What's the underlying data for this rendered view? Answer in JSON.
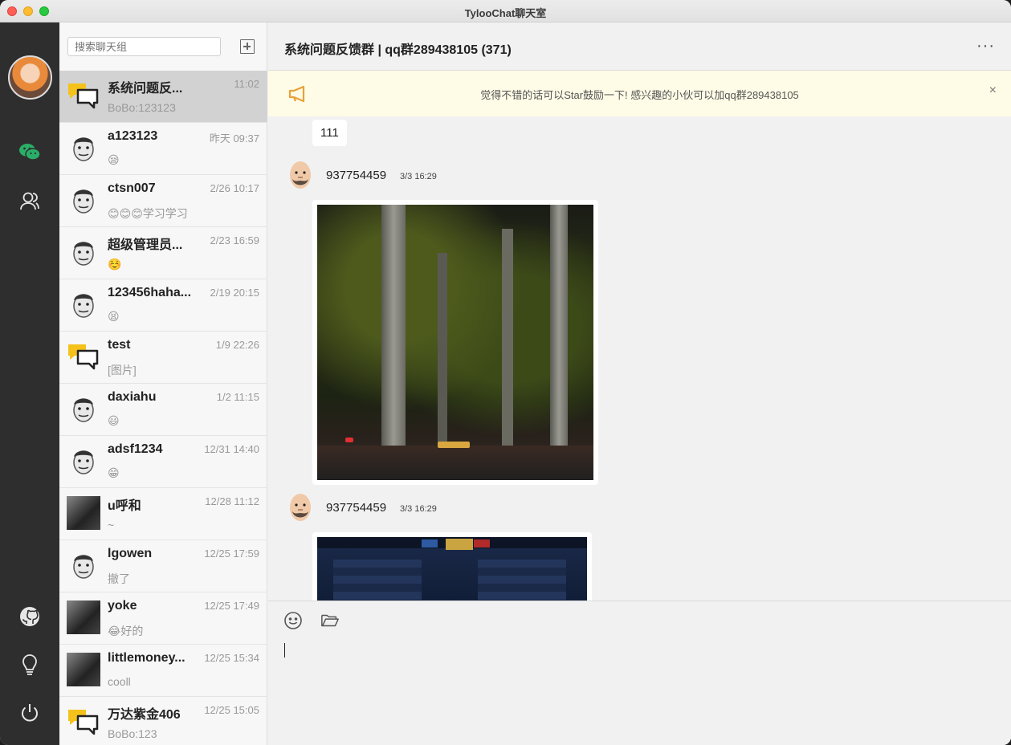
{
  "window": {
    "title": "TylooChat聊天室"
  },
  "search": {
    "placeholder": "搜索聊天组"
  },
  "conversations": [
    {
      "name": "系统问题反...",
      "time": "11:02",
      "preview": "BoBo:123123",
      "avatar": "group-chat-icon",
      "active": true
    },
    {
      "name": "a123123",
      "time": "昨天 09:37",
      "preview": "😪",
      "avatar": "cartoon-face"
    },
    {
      "name": "ctsn007",
      "time": "2/26 10:17",
      "preview": "😊😊😊学习学习",
      "avatar": "cartoon-face"
    },
    {
      "name": "超级管理员...",
      "time": "2/23 16:59",
      "preview": "☺️",
      "avatar": "cartoon-face"
    },
    {
      "name": "123456haha...",
      "time": "2/19 20:15",
      "preview": "😫",
      "avatar": "cartoon-face"
    },
    {
      "name": "test",
      "time": "1/9 22:26",
      "preview": "[图片]",
      "avatar": "group-chat-icon"
    },
    {
      "name": "daxiahu",
      "time": "1/2 11:15",
      "preview": "😃",
      "avatar": "cartoon-face"
    },
    {
      "name": "adsf1234",
      "time": "12/31 14:40",
      "preview": "😁",
      "avatar": "cartoon-face"
    },
    {
      "name": "u呼和",
      "time": "12/28 11:12",
      "preview": "~",
      "avatar": "photo"
    },
    {
      "name": "lgowen",
      "time": "12/25 17:59",
      "preview": "撤了",
      "avatar": "cartoon-face"
    },
    {
      "name": "yoke",
      "time": "12/25 17:49",
      "preview": "😂好的",
      "avatar": "photo"
    },
    {
      "name": "littlemoney...",
      "time": "12/25 15:34",
      "preview": "cooll",
      "avatar": "photo"
    },
    {
      "name": "万达紫金406",
      "time": "12/25 15:05",
      "preview": "BoBo:123",
      "avatar": "group-chat-icon"
    }
  ],
  "chat": {
    "title": "系统问题反馈群 | qq群289438105 (371)",
    "more_label": "···",
    "notice": "觉得不错的话可以Star鼓励一下! 感兴趣的小伙可以加qq群289438105",
    "notice_close": "×",
    "messages": [
      {
        "type": "text",
        "text": "111"
      },
      {
        "type": "image",
        "user": "937754459",
        "time": "3/3 16:29"
      },
      {
        "type": "image",
        "user": "937754459",
        "time": "3/3 16:29"
      }
    ]
  },
  "colors": {
    "rail": "#2e2e2e",
    "accent": "#2aae67",
    "notice_bg": "#fefbe6",
    "notice_icon": "#e8a23a"
  }
}
